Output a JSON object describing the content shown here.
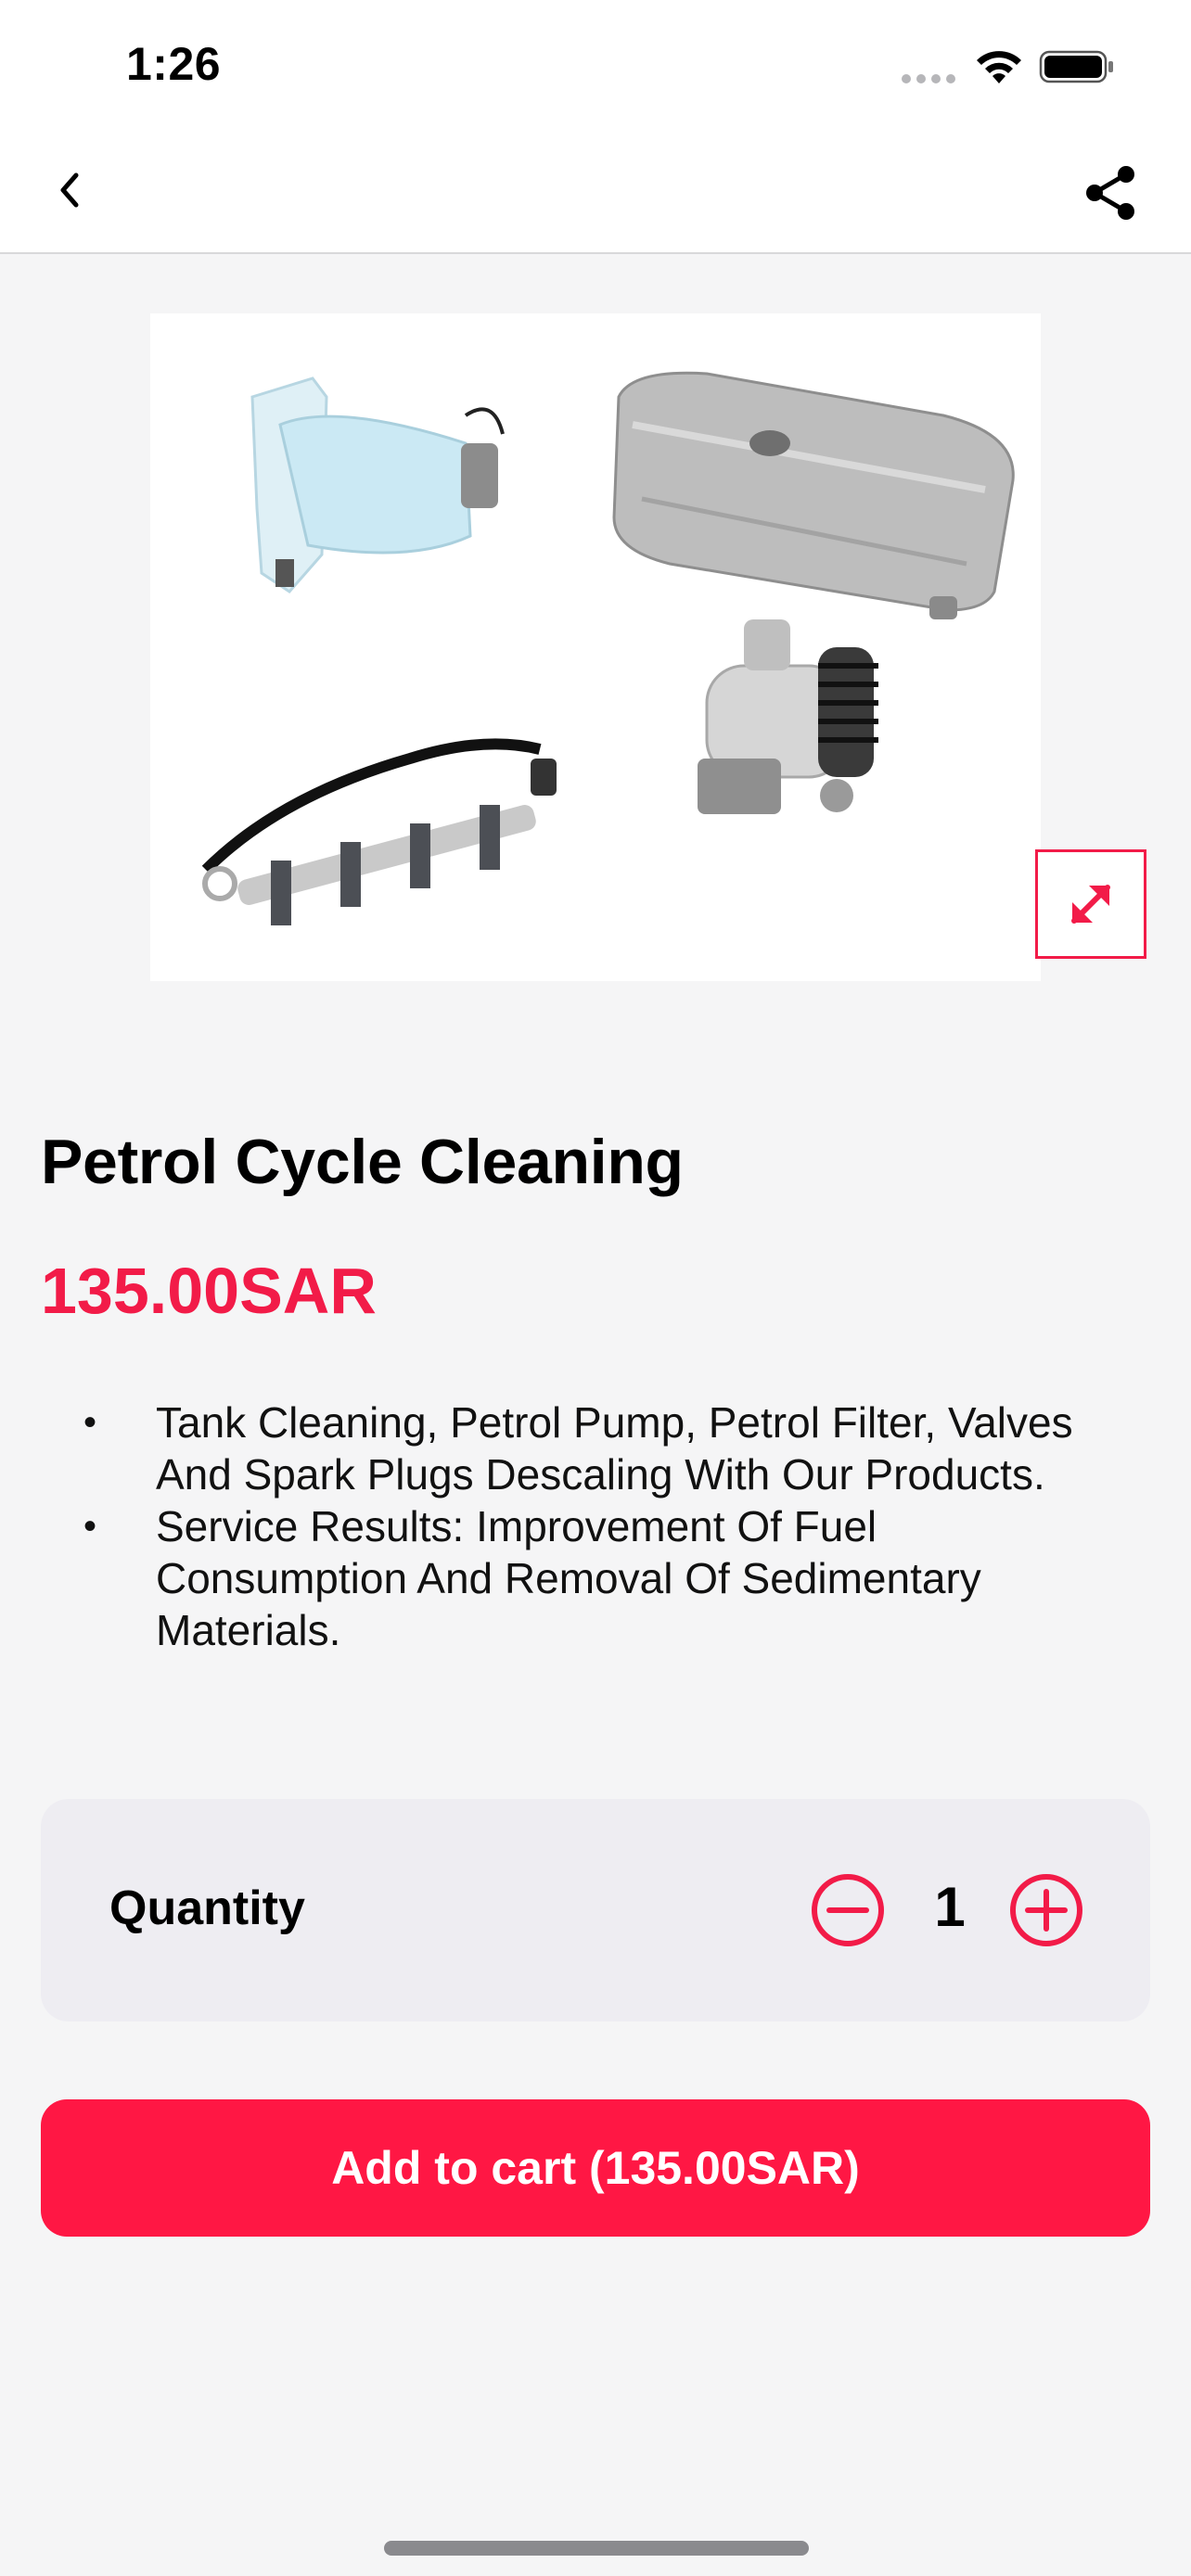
{
  "status_bar": {
    "time": "1:26",
    "icons": [
      "signal-icon",
      "wifi-icon",
      "battery-icon"
    ]
  },
  "nav": {
    "back_icon": "chevron-left-icon",
    "share_icon": "share-icon"
  },
  "product": {
    "image_alt": "Fuel system parts",
    "title": "Petrol Cycle Cleaning",
    "price": "135.00SAR",
    "description": [
      "Tank Cleaning, Petrol Pump, Petrol Filter, Valves And Spark Plugs Descaling With Our Products.",
      "Service Results: Improvement Of Fuel Consumption And Removal Of Sedimentary Materials."
    ]
  },
  "quantity": {
    "label": "Quantity",
    "value": "1"
  },
  "cart": {
    "button_label": "Add to cart (135.00SAR)"
  },
  "colors": {
    "accent": "#f21b48",
    "button": "#ff1744",
    "card_bg": "#eeedf2",
    "page_bg": "#f5f5f6"
  }
}
